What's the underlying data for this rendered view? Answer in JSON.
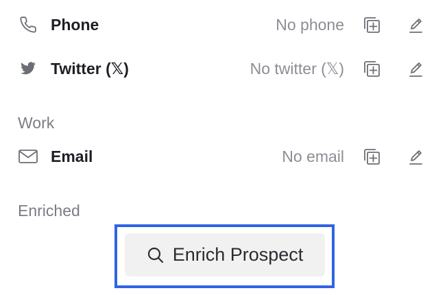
{
  "contacts": [
    {
      "label": "Phone",
      "value": "No phone",
      "icon": "phone-icon"
    },
    {
      "label": "Twitter (𝕏)",
      "value": "No twitter (𝕏)",
      "icon": "twitter-icon"
    }
  ],
  "work_section": {
    "heading": "Work",
    "items": [
      {
        "label": "Email",
        "value": "No email",
        "icon": "mail-icon"
      }
    ]
  },
  "enriched_section": {
    "heading": "Enriched",
    "button_label": "Enrich Prospect",
    "button_icon": "search-icon"
  },
  "colors": {
    "label": "#1d1f24",
    "muted": "#8b8e94",
    "focus_ring": "#2f63e6",
    "button_bg": "#f1f1f2"
  }
}
